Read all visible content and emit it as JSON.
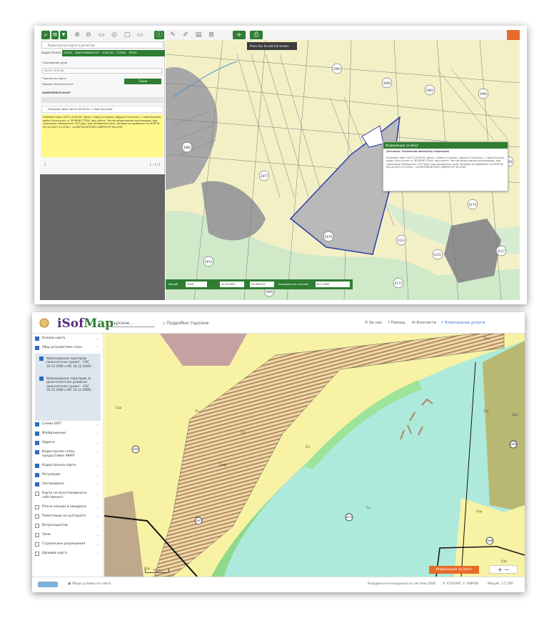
{
  "screen1": {
    "toolbar": {
      "icons": [
        "search-icon",
        "layers-icon",
        "zoom-in-icon",
        "zoom-out-icon",
        "bookmark-icon",
        "globe-icon",
        "window-icon",
        "screen-icon",
        "info-icon"
      ],
      "tooltip_text": "Press  Esc  to exit full screen"
    },
    "sidebar": {
      "search_placeholder": "Кадастрална карта и регистри",
      "tabs": [
        "КАДАСТРАЛНА",
        "КАРТА",
        "ИДЕНТИФИКАТОР",
        "СПИСЪК",
        "ГОЛЯМ",
        "ТЕРЕН"
      ],
      "identifier_label": "Съкращение думи",
      "identifier_value": "46721.5076.56",
      "option_1": "Търсене по карта",
      "option_2": "Покажи 100 резултата",
      "search_button": "Търси",
      "results_label": "НАМЕРЕНИ В КООР",
      "result_title": "Поземлен имот 46721.5076.56, с. Нови Бусилия",
      "info_text": "Поземлен имот 46721.5076.56, област София (столица), община Столична, с. Нови Бусилия, район Овча купел, м. ЗЕЛЕНИ СТРЪК, вид собств. Частна общественни организации, вид територия: Земеделска, НТП Друг вид земеделска земя. Заповед за одобрение на КККР № РД-18-93/27.03.2018 г. на ИЗПЪЛНИТЕЛЕН ДИРЕКТОР НА АГКК",
      "pager": "1",
      "pager_count": "1 - 1 / 1"
    },
    "bottombar": {
      "label_1": "Мащаб",
      "value_1": "5000",
      "label_2": "42.671850",
      "value_2": "23.083251",
      "label_3": "Координатна система",
      "value_3": "БГС 2005"
    },
    "popup": {
      "title": "Информация за обект",
      "heading": "(Катешка: Поземлени имоти/Кад територия)",
      "body": "Поземлен имот 46721.5076.56, област София (столица), община Столична, с. Нови Бусилия, район Овча купел, м. ЗЕЛЕНИ СТРЪК, вид собств. Частна общественни организации, вид територия: Земеделска, НТП Друг вид земеделска земя. Заповед за одобрение на КККР № РД-18-93/27.03.2018 г. на ИЗПЪЛНИТЕЛЕН ДИРЕКТОР НА АГКК"
    },
    "map_labels": [
      "5679",
      "3677",
      "3680",
      "5690",
      "4123",
      "3998",
      "3984",
      "4101",
      "4172",
      "3990",
      "4127",
      "3992",
      "3993",
      "3672",
      "4109",
      "3690",
      "4170"
    ]
  },
  "screen2": {
    "logo_main": "iSof",
    "logo_sub": "Map",
    "search_placeholder": "Търсене...",
    "advanced_search": "Подробно търсене",
    "links": [
      "За нас",
      "Помощ",
      "Контакти",
      "Електронни услуги"
    ],
    "layers": [
      {
        "label": "Базова карта",
        "checked": true
      },
      {
        "label": "Общ устройствен план",
        "checked": true
      },
      {
        "label": "Урбанизирани територии (окончателен проект - СОС 16.11.2006 и МС 16.12.2006)",
        "checked": true
      },
      {
        "label": "Урбанизирани територии за делеготентство развитие (окончателен проект - СОС 16.11.2006 и МС 16.12.2006)",
        "checked": true
      },
      {
        "label": "Схеми ОУП",
        "checked": true
      },
      {
        "label": "Изображения",
        "checked": true
      },
      {
        "label": "Адреси",
        "checked": true
      },
      {
        "label": "Кадастрален план, предоставен АККР",
        "checked": true
      },
      {
        "label": "Кадастрална карта",
        "checked": true
      },
      {
        "label": "Регулация",
        "checked": true
      },
      {
        "label": "Застрояване",
        "checked": true
      },
      {
        "label": "Карта на възстановената собственост",
        "checked": false
      },
      {
        "label": "Речни секции и хандраси",
        "checked": false
      },
      {
        "label": "Паметници на културата",
        "checked": false
      },
      {
        "label": "Ветрозащитни",
        "checked": false
      },
      {
        "label": "Зони",
        "checked": false
      },
      {
        "label": "Строителни разрешения",
        "checked": false
      },
      {
        "label": "Шумова карта",
        "checked": false
      }
    ],
    "map_labels": [
      "Сср",
      "Тп",
      "Сп",
      "Смф",
      "Сп",
      "Сс",
      "Тгз",
      "Тст",
      "Смс",
      "Сср",
      "Сср",
      "Сзп"
    ],
    "circle_labels": [
      "0059",
      "0357",
      "0370",
      "0009",
      "0008"
    ],
    "info_button": "Информация за обект",
    "zoom_label": "+ −",
    "scale_label": "300 m",
    "footer_left": "Общи условия на сайта",
    "footer_coord_system": "Координатна координатна система 2005",
    "footer_coords": "X: 4720360, Y: 308938",
    "footer_scale": "Мащаб: 1:2 500"
  }
}
